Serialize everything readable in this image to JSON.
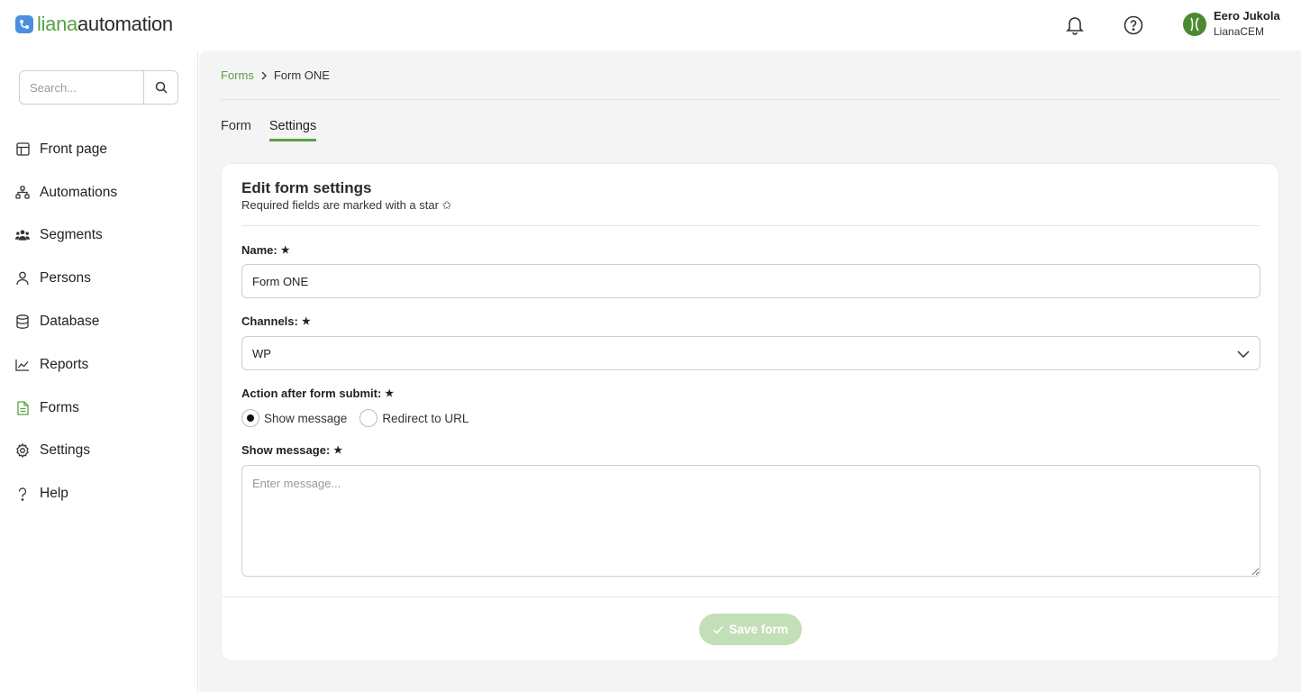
{
  "brand": {
    "liana": "liana",
    "automation": "automation",
    "accent": "#5aa046"
  },
  "header": {
    "user_name": "Eero Jukola",
    "user_org": "LianaCEM"
  },
  "sidebar": {
    "search_placeholder": "Search...",
    "items": [
      {
        "label": "Front page",
        "icon": "grid-icon"
      },
      {
        "label": "Automations",
        "icon": "flow-icon"
      },
      {
        "label": "Segments",
        "icon": "users-icon"
      },
      {
        "label": "Persons",
        "icon": "person-icon"
      },
      {
        "label": "Database",
        "icon": "database-icon"
      },
      {
        "label": "Reports",
        "icon": "chart-icon"
      },
      {
        "label": "Forms",
        "icon": "form-icon",
        "active": true
      },
      {
        "label": "Settings",
        "icon": "gear-icon"
      },
      {
        "label": "Help",
        "icon": "question-icon"
      }
    ]
  },
  "breadcrumb": {
    "parent": "Forms",
    "current": "Form ONE"
  },
  "tabs": [
    {
      "label": "Form"
    },
    {
      "label": "Settings",
      "active": true
    }
  ],
  "card": {
    "title": "Edit form settings",
    "subtitle": "Required fields are marked with a star ✩",
    "name_label": "Name:",
    "name_value": "Form ONE",
    "channels_label": "Channels:",
    "channels_value": "WP",
    "action_label": "Action after form submit:",
    "radio_show": "Show message",
    "radio_redirect": "Redirect to URL",
    "radio_selected": "Show message",
    "message_label": "Show message:",
    "message_placeholder": "Enter message...",
    "save_label": "Save form",
    "star": "★"
  }
}
